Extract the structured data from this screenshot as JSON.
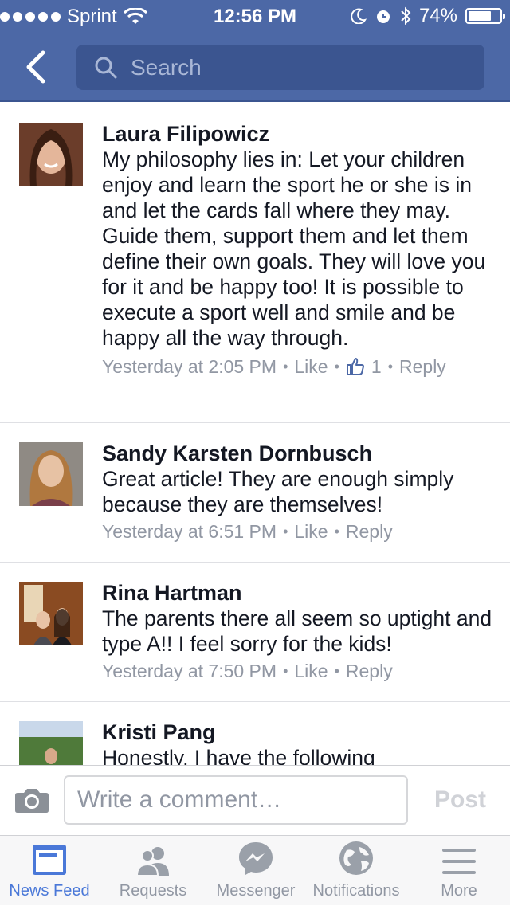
{
  "status_bar": {
    "carrier": "Sprint",
    "time": "12:56 PM",
    "battery_percent": "74%",
    "battery_level": 0.74
  },
  "nav": {
    "search_placeholder": "Search"
  },
  "comments": [
    {
      "name": "Laura Filipowicz",
      "text": "My philosophy lies in: Let your children enjoy and learn the sport he or she is in and let the cards fall where they may. Guide them, support them and let them define their own goals. They will love you for it and be happy too! It is possible to execute a sport well and smile and be happy all the way through.",
      "time": "Yesterday at 2:05 PM",
      "like_label": "Like",
      "like_count": "1",
      "reply_label": "Reply"
    },
    {
      "name": "Sandy Karsten Dornbusch",
      "text": "Great article!  They are enough simply because they are themselves!",
      "time": "Yesterday at 6:51 PM",
      "like_label": "Like",
      "reply_label": "Reply"
    },
    {
      "name": "Rina Hartman",
      "text": "The parents there all seem so uptight and type A!! I feel sorry for the kids!",
      "time": "Yesterday at 7:50 PM",
      "like_label": "Like",
      "reply_label": "Reply"
    },
    {
      "name": "Kristi Pang",
      "text": "Honestly, I have the following"
    }
  ],
  "composer": {
    "placeholder": "Write a comment…",
    "post_label": "Post"
  },
  "tabs": [
    {
      "label": "News Feed",
      "icon": "news-feed-icon",
      "active": true
    },
    {
      "label": "Requests",
      "icon": "friend-requests-icon"
    },
    {
      "label": "Messenger",
      "icon": "messenger-icon"
    },
    {
      "label": "Notifications",
      "icon": "globe-icon"
    },
    {
      "label": "More",
      "icon": "menu-icon"
    }
  ],
  "colors": {
    "brand_blue": "#4c68a6",
    "active_tab": "#4a78d8",
    "meta_gray": "#9197a3"
  }
}
